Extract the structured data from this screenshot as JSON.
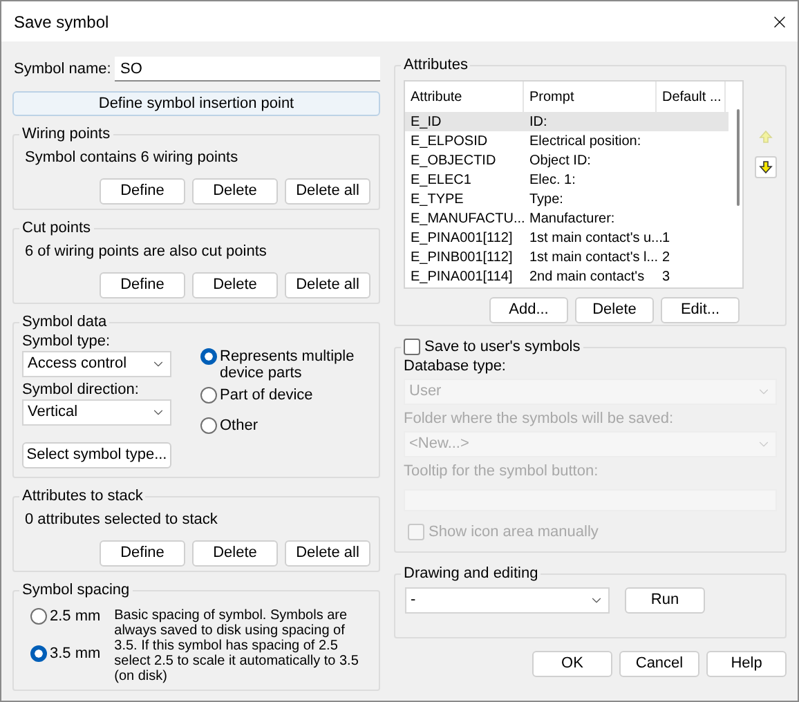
{
  "window": {
    "title": "Save symbol"
  },
  "symbol_name": {
    "label": "Symbol name:",
    "value": "SO"
  },
  "insertion_button": "Define symbol insertion point",
  "wiring_points": {
    "title": "Wiring points",
    "text": "Symbol contains 6 wiring points",
    "buttons": [
      "Define",
      "Delete",
      "Delete all"
    ]
  },
  "cut_points": {
    "title": "Cut points",
    "text": "6 of wiring points are also cut points",
    "buttons": [
      "Define",
      "Delete",
      "Delete all"
    ]
  },
  "symbol_data": {
    "title": "Symbol data",
    "type_label": "Symbol type:",
    "type_value": "Access control",
    "direction_label": "Symbol direction:",
    "direction_value": "Vertical",
    "select_button": "Select symbol type...",
    "options": [
      {
        "label": "Represents multiple device parts",
        "selected": true
      },
      {
        "label": "Part of device",
        "selected": false
      },
      {
        "label": "Other",
        "selected": false
      }
    ]
  },
  "attributes_to_stack": {
    "title": "Attributes to stack",
    "text": "0 attributes selected to stack",
    "buttons": [
      "Define",
      "Delete",
      "Delete all"
    ]
  },
  "symbol_spacing": {
    "title": "Symbol spacing",
    "options": [
      {
        "label": "2.5 mm",
        "selected": false
      },
      {
        "label": "3.5 mm",
        "selected": true
      }
    ],
    "description": "Basic spacing of symbol. Symbols are always saved to disk using spacing of 3.5. If this symbol has spacing of 2.5 select 2.5 to scale it automatically to 3.5 (on disk)"
  },
  "attributes": {
    "title": "Attributes",
    "columns": [
      "Attribute",
      "Prompt",
      "Default ..."
    ],
    "rows": [
      {
        "cells": [
          "E_ID",
          "ID:",
          ""
        ],
        "selected": true
      },
      {
        "cells": [
          "E_ELPOSID",
          "Electrical position:",
          ""
        ],
        "selected": false
      },
      {
        "cells": [
          "E_OBJECTID",
          "Object ID:",
          ""
        ],
        "selected": false
      },
      {
        "cells": [
          "E_ELEC1",
          "Elec. 1:",
          ""
        ],
        "selected": false
      },
      {
        "cells": [
          "E_TYPE",
          "Type:",
          ""
        ],
        "selected": false
      },
      {
        "cells": [
          "E_MANUFACTU...",
          "Manufacturer:",
          ""
        ],
        "selected": false
      },
      {
        "cells": [
          "E_PINA001[112]",
          "1st main contact's u...",
          "1"
        ],
        "selected": false
      },
      {
        "cells": [
          "E_PINB001[112]",
          "1st main contact's l...",
          "2"
        ],
        "selected": false
      },
      {
        "cells": [
          "E_PINA001[114]",
          "2nd main contact's",
          "3"
        ],
        "selected": false
      }
    ],
    "move_up": {
      "disabled": true
    },
    "move_down": {
      "disabled": false
    },
    "buttons": [
      "Add...",
      "Delete",
      "Edit..."
    ]
  },
  "user_symbols": {
    "label": "Save to user's symbols",
    "checked": false,
    "database_label": "Database type:",
    "database_value": "User",
    "folder_label": "Folder where the symbols will be saved:",
    "folder_value": "<New...>",
    "tooltip_label": "Tooltip for the symbol button:",
    "show_icon": {
      "label": "Show icon area manually",
      "checked": false
    }
  },
  "drawing": {
    "title": "Drawing and editing",
    "value": "-",
    "button": "Run"
  },
  "footer_buttons": [
    "OK",
    "Cancel",
    "Help"
  ]
}
